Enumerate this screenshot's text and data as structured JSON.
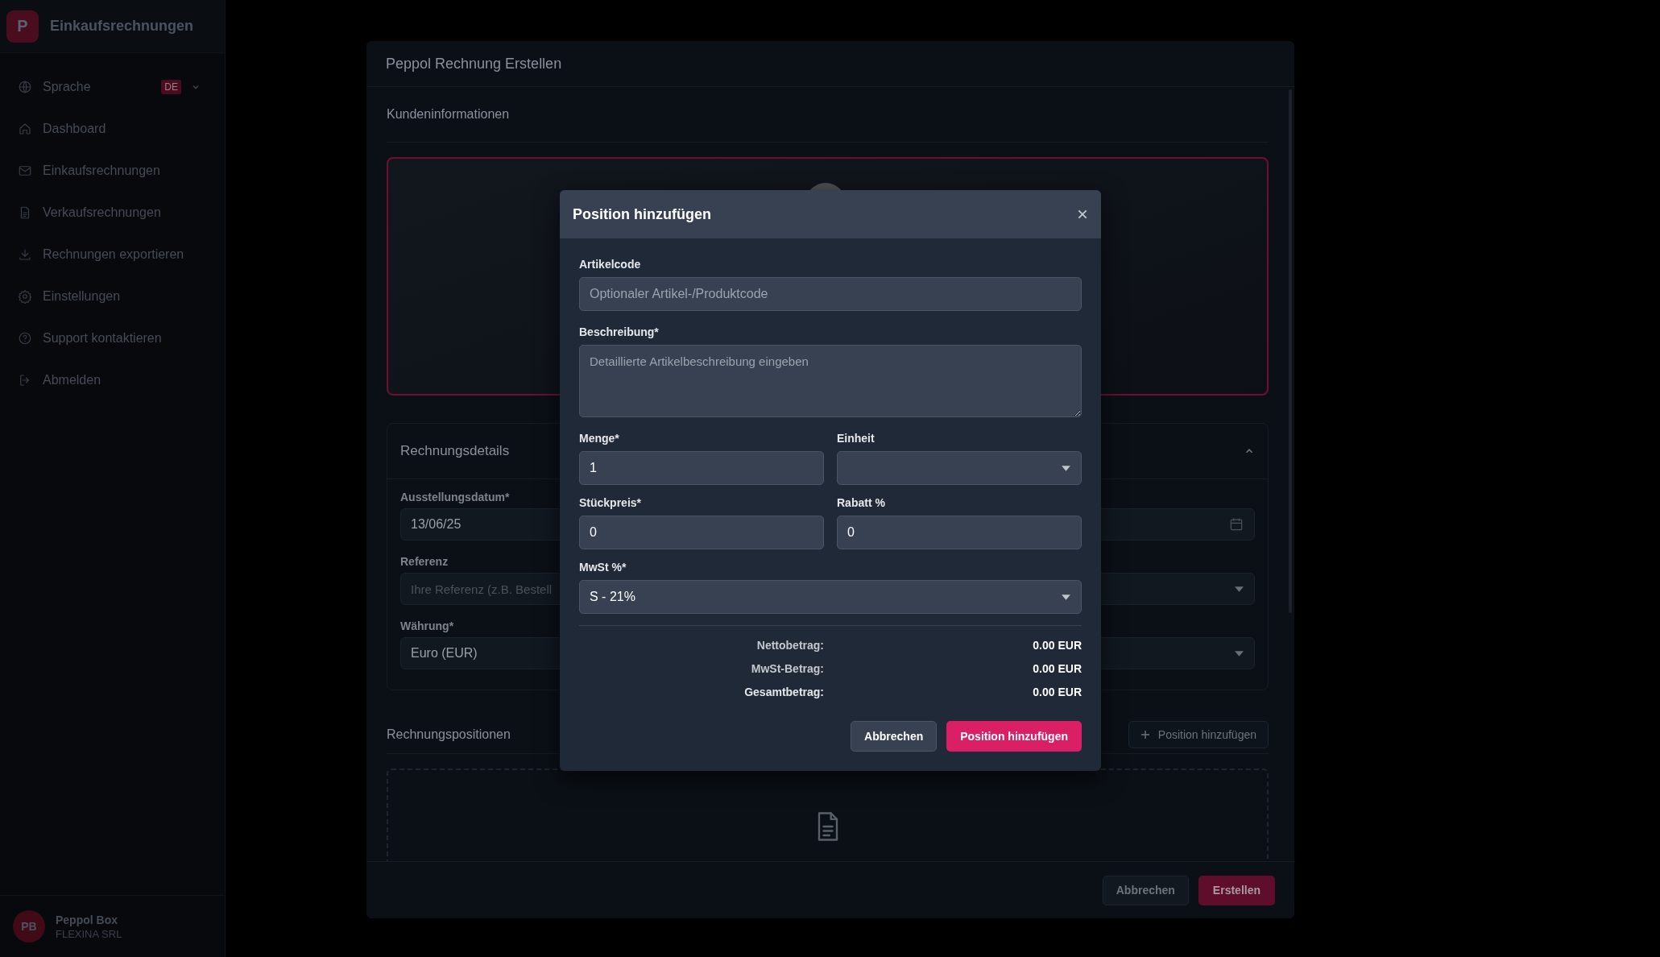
{
  "sidebar": {
    "logo_letter": "P",
    "title": "Einkaufsrechnungen",
    "items": [
      {
        "label": "Sprache",
        "badge": "DE"
      },
      {
        "label": "Dashboard"
      },
      {
        "label": "Einkaufsrechnungen"
      },
      {
        "label": "Verkaufsrechnungen"
      },
      {
        "label": "Rechnungen exportieren"
      },
      {
        "label": "Einstellungen"
      },
      {
        "label": "Support kontaktieren"
      },
      {
        "label": "Abmelden"
      }
    ],
    "user": {
      "initials": "PB",
      "name": "Peppol Box",
      "company": "FLEXINA SRL"
    }
  },
  "dialog": {
    "title": "Peppol Rechnung Erstellen",
    "customer_section": {
      "title": "Kundeninformationen"
    },
    "details": {
      "title": "Rechnungsdetails",
      "fields": [
        {
          "label": "Ausstellungsdatum*",
          "value": "13/06/25"
        },
        {
          "label": "Referenz",
          "placeholder": "Ihre Referenz (z.B. Bestell"
        },
        {
          "label": "Währung*",
          "value": "Euro (EUR)"
        }
      ]
    },
    "positions": {
      "title": "Rechnungspositionen",
      "add_button": "Position hinzufügen"
    },
    "buttons": {
      "cancel": "Abbrechen",
      "create": "Erstellen"
    }
  },
  "modal": {
    "title": "Position hinzufügen",
    "article_code": {
      "label": "Artikelcode",
      "placeholder": "Optionaler Artikel-/Produktcode"
    },
    "description": {
      "label": "Beschreibung*",
      "placeholder": "Detaillierte Artikelbeschreibung eingeben"
    },
    "quantity": {
      "label": "Menge*",
      "value": "1"
    },
    "unit": {
      "label": "Einheit"
    },
    "unit_price": {
      "label": "Stückpreis*",
      "value": "0"
    },
    "discount": {
      "label": "Rabatt %",
      "value": "0"
    },
    "vat": {
      "label": "MwSt %*",
      "value": "S - 21%"
    },
    "totals": [
      {
        "label": "Nettobetrag:",
        "value": "0.00 EUR"
      },
      {
        "label": "MwSt-Betrag:",
        "value": "0.00 EUR"
      },
      {
        "label": "Gesamtbetrag:",
        "value": "0.00 EUR"
      }
    ],
    "buttons": {
      "cancel": "Abbrechen",
      "submit": "Position hinzufügen"
    }
  }
}
